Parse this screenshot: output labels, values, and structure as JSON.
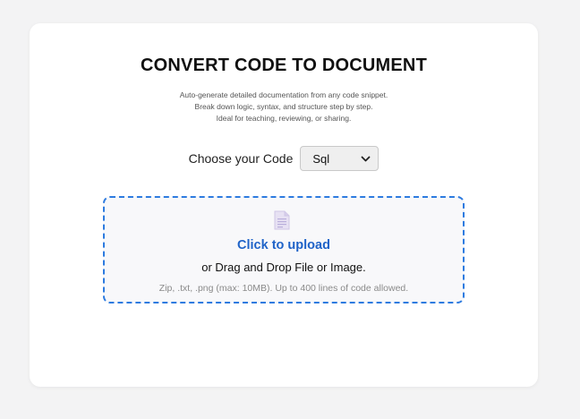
{
  "header": {
    "title": "CONVERT CODE TO DOCUMENT",
    "subtitle_lines": [
      "Auto-generate detailed documentation from any code snippet.",
      "Break down logic, syntax, and structure step by step.",
      "Ideal for teaching, reviewing, or sharing."
    ]
  },
  "code_selector": {
    "label": "Choose your Code",
    "selected": "Sql"
  },
  "upload": {
    "icon": "document-icon",
    "link_text": "Click to upload",
    "drag_text": "or Drag and Drop File or Image.",
    "hint": "Zip, .txt, .png (max: 10MB). Up to 400 lines of code allowed."
  },
  "colors": {
    "accent": "#1f63c8",
    "dropzone_border": "#2d7be0",
    "icon_lavender": "#d9d2ec"
  }
}
